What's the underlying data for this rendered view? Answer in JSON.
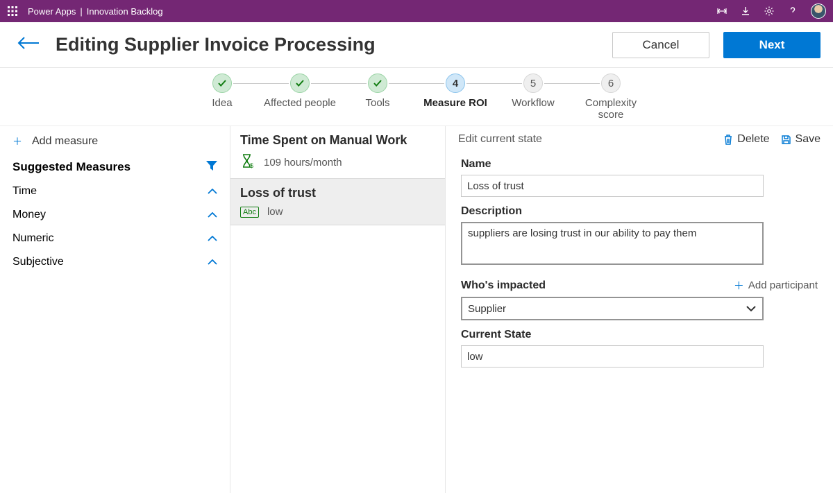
{
  "topbar": {
    "app": "Power Apps",
    "divider": "|",
    "context": "Innovation Backlog"
  },
  "header": {
    "title": "Editing Supplier Invoice Processing",
    "cancel": "Cancel",
    "next": "Next"
  },
  "stepper": [
    {
      "label": "Idea",
      "state": "done"
    },
    {
      "label": "Affected people",
      "state": "done"
    },
    {
      "label": "Tools",
      "state": "done"
    },
    {
      "num": "4",
      "label": "Measure ROI",
      "state": "current"
    },
    {
      "num": "5",
      "label": "Workflow",
      "state": "future"
    },
    {
      "num": "6",
      "label": "Complexity score",
      "state": "future"
    }
  ],
  "left": {
    "add": "Add measure",
    "heading": "Suggested Measures",
    "categories": [
      "Time",
      "Money",
      "Numeric",
      "Subjective"
    ]
  },
  "measures": [
    {
      "title": "Time Spent on Manual Work",
      "value": "109 hours/month",
      "kind": "time",
      "selected": false
    },
    {
      "title": "Loss of trust",
      "value": "low",
      "kind": "subjective",
      "selected": true
    }
  ],
  "right": {
    "headTitle": "Edit current state",
    "delete": "Delete",
    "save": "Save",
    "nameLabel": "Name",
    "nameValue": "Loss of trust",
    "descLabel": "Description",
    "descValue": "suppliers are losing trust in our ability to pay them",
    "whoLabel": "Who's impacted",
    "addParticipant": "Add participant",
    "whoValue": "Supplier",
    "stateLabel": "Current State",
    "stateValue": "low"
  }
}
